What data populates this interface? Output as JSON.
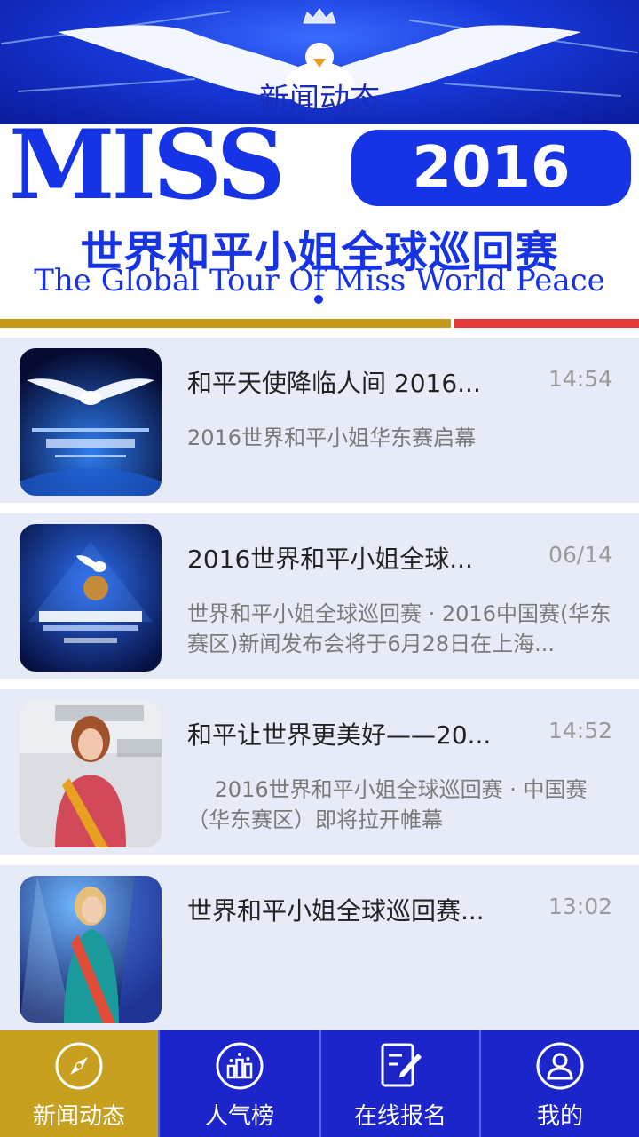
{
  "banner": {
    "title": "新闻动态",
    "miss_text": "MISS",
    "year": "2016",
    "cn_title": "世界和平小姐全球巡回赛",
    "en_title": "The Global Tour Of Miss World Peace"
  },
  "news": [
    {
      "title": "和平天使降临人间  2016...",
      "time": "14:54",
      "desc": "2016世界和平小姐华东赛启幕",
      "thumb_icon": "dove-press-conference-image"
    },
    {
      "title": "2016世界和平小姐全球...",
      "time": "06/14",
      "desc": "世界和平小姐全球巡回赛 · 2016中国赛(华东赛区)新闻发布会将于6月28日在上海...",
      "thumb_icon": "dove-globe-image"
    },
    {
      "title": "和平让世界更美好——20...",
      "time": "14:52",
      "desc": "    2016世界和平小姐全球巡回赛 · 中国赛（华东赛区）即将拉开帷幕",
      "thumb_icon": "contestant-photo"
    },
    {
      "title": "世界和平小姐全球巡回赛...",
      "time": "13:02",
      "desc": "",
      "thumb_icon": "contestant-stage-photo"
    }
  ],
  "nav": {
    "tabs": [
      {
        "label": "新闻动态",
        "icon": "compass-icon",
        "active": true
      },
      {
        "label": "人气榜",
        "icon": "ranking-icon",
        "active": false
      },
      {
        "label": "在线报名",
        "icon": "edit-form-icon",
        "active": false
      },
      {
        "label": "我的",
        "icon": "user-icon",
        "active": false
      }
    ]
  },
  "colors": {
    "brand_blue": "#1633e6",
    "nav_blue": "#1b25c9",
    "nav_active_gold": "#c6a01e",
    "list_bg": "#e6ebf7",
    "bar_gold": "#c69a18",
    "bar_red": "#e83a3a"
  }
}
